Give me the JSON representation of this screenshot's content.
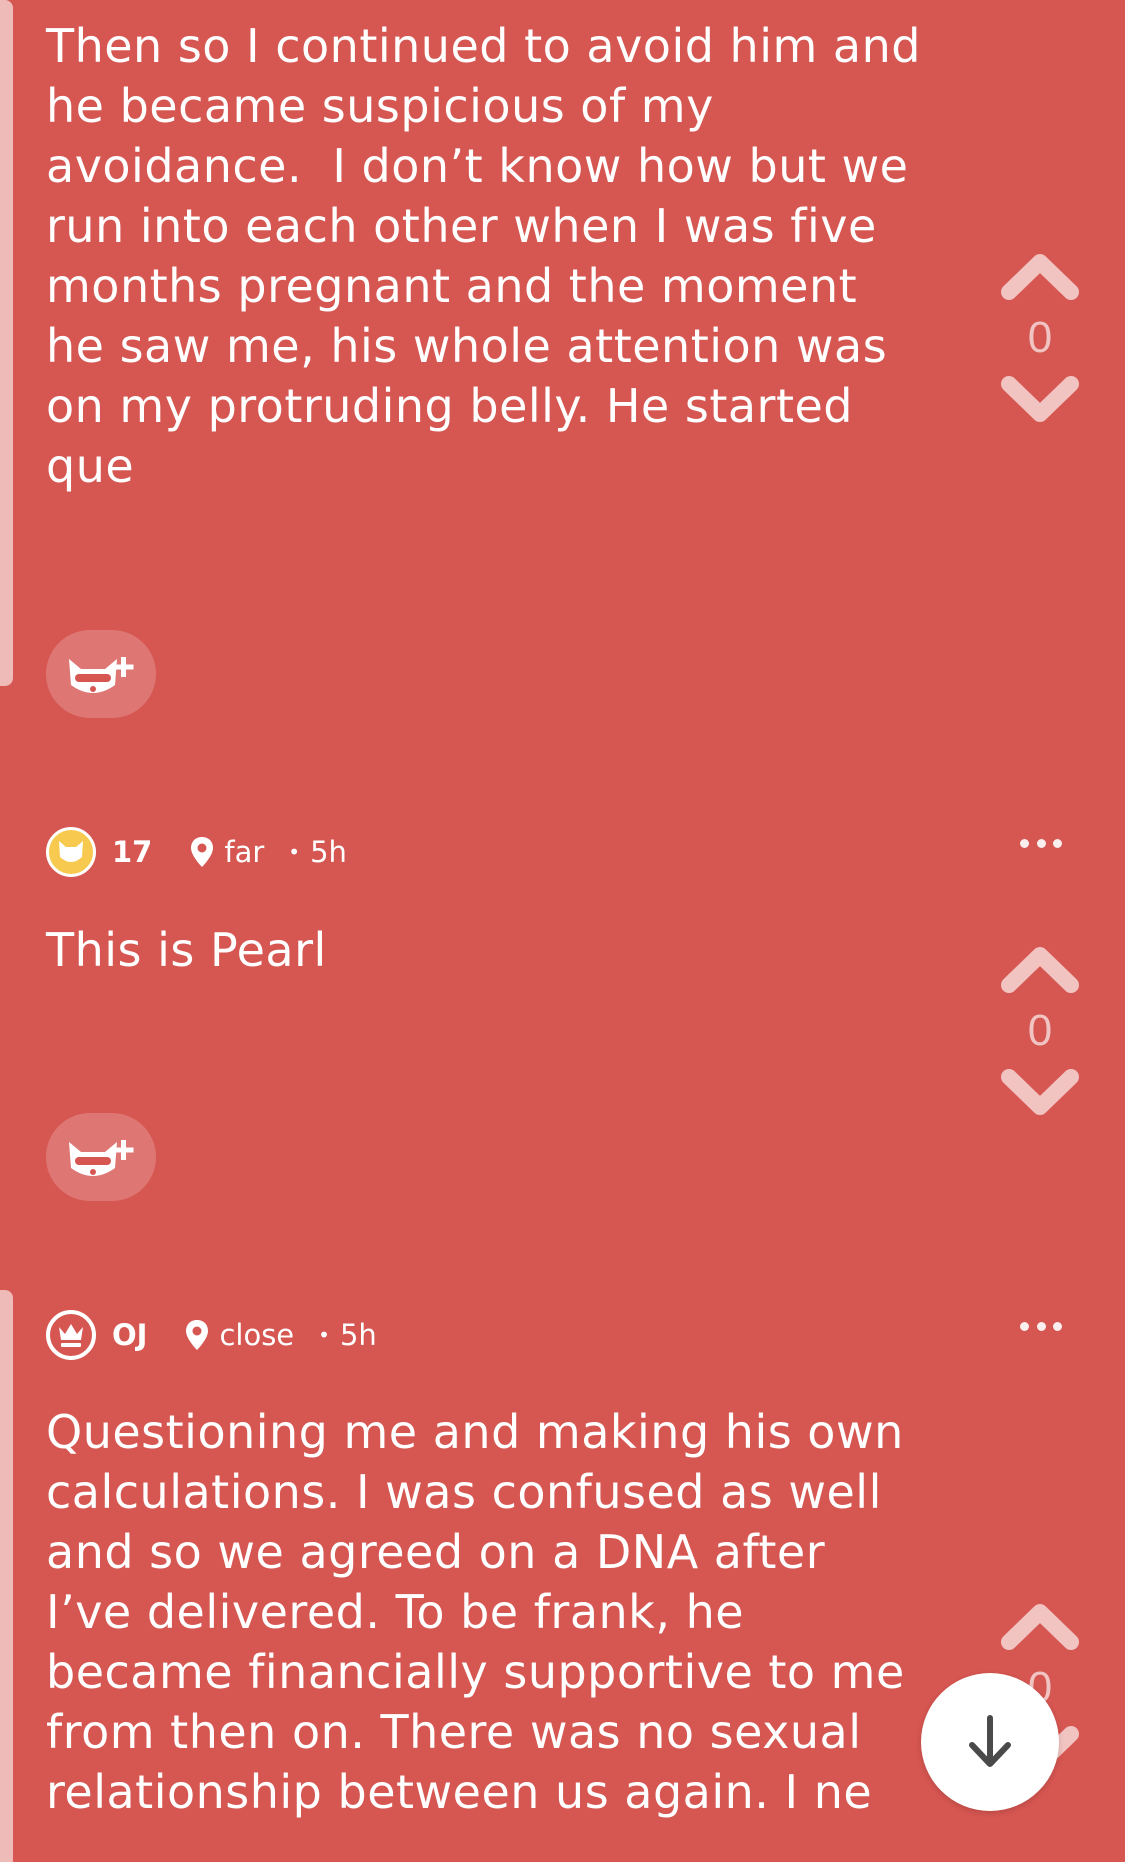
{
  "colors": {
    "background": "#d65651",
    "vote_arrow": "#f1c3c1",
    "badge_gold": "#f7c94f",
    "fab_bg": "#ffffff",
    "fab_arrow": "#4a4a4a"
  },
  "posts": [
    {
      "author": "",
      "text": "Then so I continued to avoid him and\nhe became suspicious of my\navoidance.  I don’t know how but we\nrun into each other when I was five\nmonths pregnant and the moment\nhe saw me, his whole attention was\non my protruding belly. He started\nque",
      "votes": "0",
      "react_icon": "mask-fox-plus-icon"
    },
    {
      "author": "17",
      "badge_icon": "cat-face-icon",
      "location": "far",
      "separator": "•",
      "time": "5h",
      "text": "This is Pearl",
      "votes": "0",
      "react_icon": "mask-fox-plus-icon"
    },
    {
      "author": "OJ",
      "badge_icon": "crown-icon",
      "location": "close",
      "separator": "•",
      "time": "5h",
      "text": "Questioning me and making his own\ncalculations. I was confused as well\nand so we agreed on a DNA after\nI’ve delivered. To be frank, he\nbecame financially supportive to me\nfrom then on. There was no sexual\nrelationship between us again. I ne",
      "votes": "0"
    }
  ],
  "fab": {
    "icon": "arrow-down-icon"
  }
}
